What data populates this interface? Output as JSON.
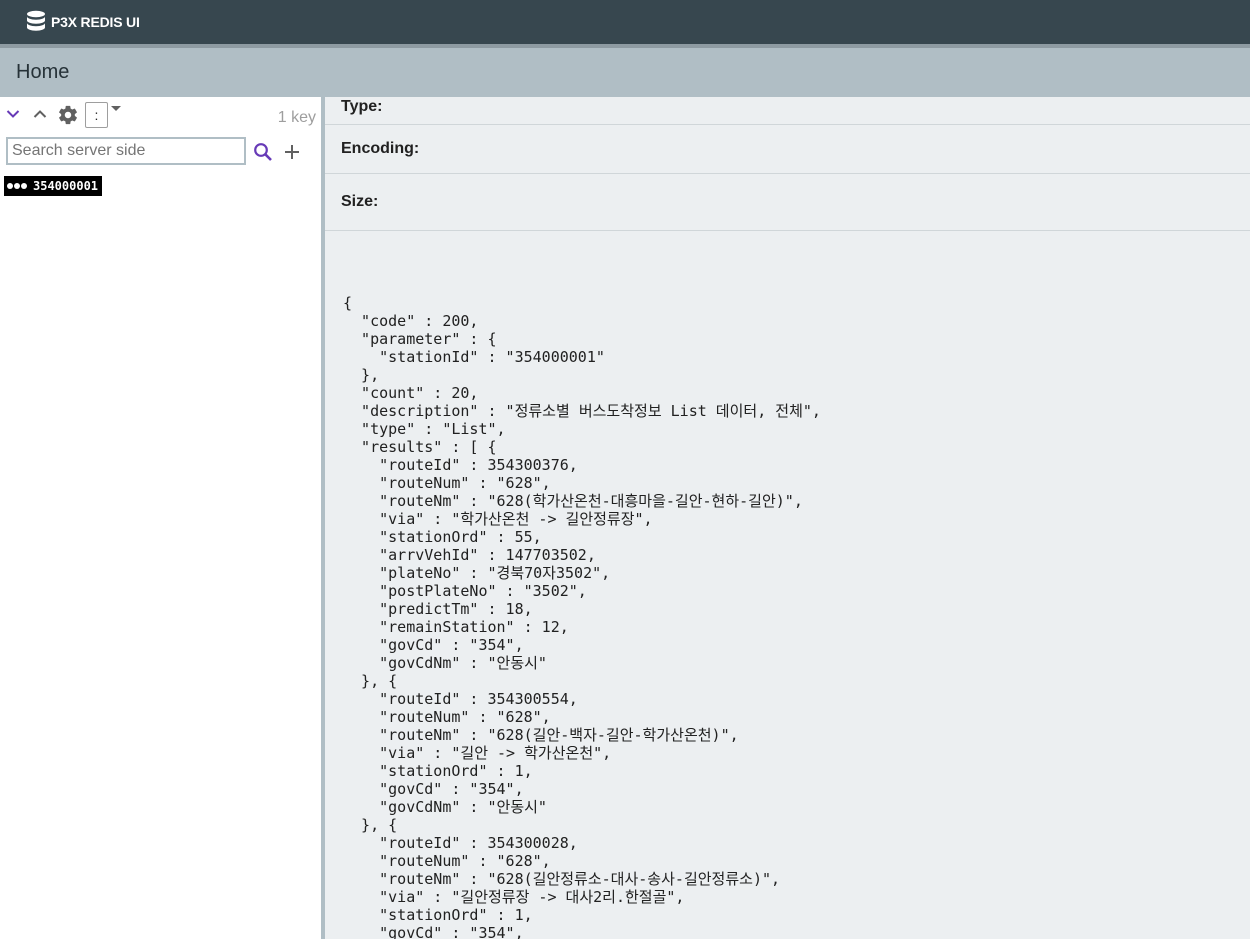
{
  "app": {
    "title": "P3X REDIS UI"
  },
  "breadcrumb": {
    "home": "Home"
  },
  "tree": {
    "separator": ":",
    "key_count": "1 key",
    "search_placeholder": "Search server side",
    "keys": [
      {
        "name": "354000001"
      }
    ]
  },
  "details": {
    "type_label": "Type:",
    "encoding_label": "Encoding:",
    "size_label": "Size:"
  },
  "value_lines": [
    "{",
    "  \"code\" : 200,",
    "  \"parameter\" : {",
    "    \"stationId\" : \"354000001\"",
    "  },",
    "  \"count\" : 20,",
    "  \"description\" : \"정류소별 버스도착정보 List 데이터, 전체\",",
    "  \"type\" : \"List\",",
    "  \"results\" : [ {",
    "    \"routeId\" : 354300376,",
    "    \"routeNum\" : \"628\",",
    "    \"routeNm\" : \"628(학가산온천-대흥마을-길안-현하-길안)\",",
    "    \"via\" : \"학가산온천 -> 길안정류장\",",
    "    \"stationOrd\" : 55,",
    "    \"arrvVehId\" : 147703502,",
    "    \"plateNo\" : \"경북70자3502\",",
    "    \"postPlateNo\" : \"3502\",",
    "    \"predictTm\" : 18,",
    "    \"remainStation\" : 12,",
    "    \"govCd\" : \"354\",",
    "    \"govCdNm\" : \"안동시\"",
    "  }, {",
    "    \"routeId\" : 354300554,",
    "    \"routeNum\" : \"628\",",
    "    \"routeNm\" : \"628(길안-백자-길안-학가산온천)\",",
    "    \"via\" : \"길안 -> 학가산온천\",",
    "    \"stationOrd\" : 1,",
    "    \"govCd\" : \"354\",",
    "    \"govCdNm\" : \"안동시\"",
    "  }, {",
    "    \"routeId\" : 354300028,",
    "    \"routeNum\" : \"628\",",
    "    \"routeNm\" : \"628(길안정류소-대사-송사-길안정류소)\",",
    "    \"via\" : \"길안정류장 -> 대사2리.한절골\",",
    "    \"stationOrd\" : 1,",
    "    \"govCd\" : \"354\","
  ],
  "icons": {
    "logo": "database-icon",
    "expand_all": "chevron-down-icon",
    "collapse_all": "chevron-up-icon",
    "settings": "gear-icon",
    "separator_dropdown": "caret-down-icon",
    "search": "search-icon",
    "add": "plus-icon",
    "key_type": "dots-icon"
  },
  "colors": {
    "topbar": "#37474f",
    "subbar": "#b0bec5",
    "accent": "#673ab7",
    "content_bg": "#eceff1"
  }
}
